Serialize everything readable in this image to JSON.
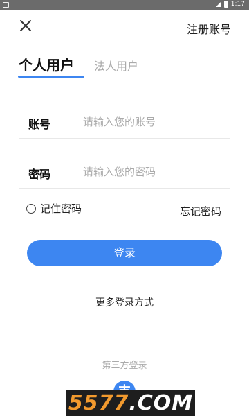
{
  "status_bar": {
    "time": "1:17"
  },
  "header": {
    "register_label": "注册账号"
  },
  "tabs": [
    {
      "label": "个人用户",
      "active": true
    },
    {
      "label": "法人用户",
      "active": false
    }
  ],
  "form": {
    "account": {
      "label": "账号",
      "placeholder": "请输入您的账号"
    },
    "password": {
      "label": "密码",
      "placeholder": "请输入您的密码"
    },
    "remember_label": "记住密码",
    "forgot_label": "忘记密码",
    "login_label": "登录"
  },
  "more_login_label": "更多登录方式",
  "third_party": {
    "label": "第三方登录",
    "icon_glyph": "支",
    "icon": "alipay-icon"
  },
  "watermark": {
    "main": "5577",
    "suffix": ".COM"
  },
  "colors": {
    "accent": "#3d86f1",
    "statusbar": "#6b6b6b",
    "muted": "#aaaaaa"
  }
}
